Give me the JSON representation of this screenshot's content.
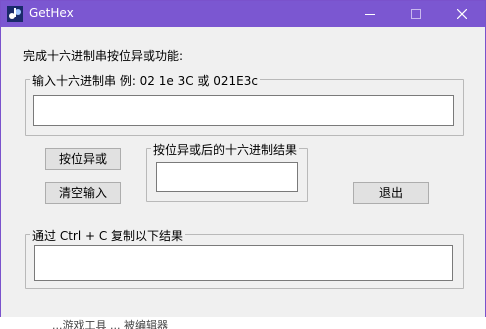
{
  "window": {
    "title": "GetHex",
    "accent": "#7b57d1"
  },
  "main": {
    "instruction": "完成十六进制串按位异或功能:",
    "input_group": {
      "legend": "输入十六进制串  例: 02 1e  3C 或 021E3c",
      "value": ""
    },
    "xor_button": "按位异或",
    "clear_button": "清空输入",
    "result_group": {
      "legend": "按位异或后的十六进制结果",
      "value": ""
    },
    "exit_button": "退出",
    "copy_group": {
      "legend": "通过 Ctrl + C 复制以下结果",
      "value": ""
    }
  },
  "background": {
    "partial_text": "...游戏工具 ... 被编辑器"
  }
}
